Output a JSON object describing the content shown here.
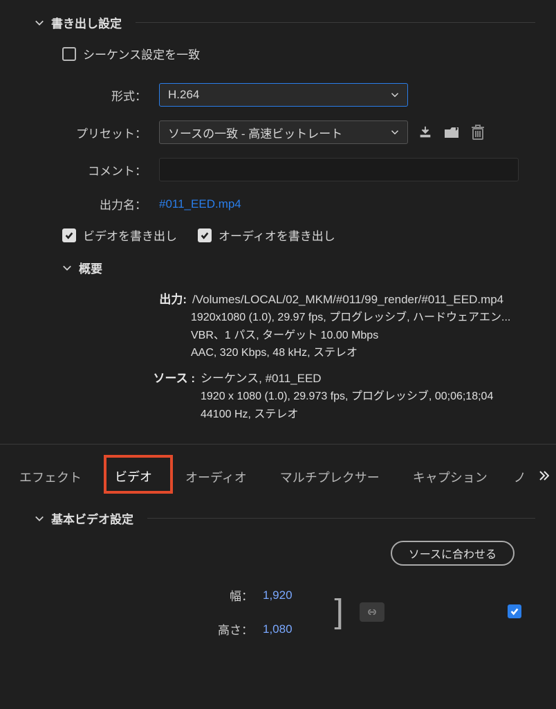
{
  "export_settings": {
    "title": "書き出し設定",
    "match_sequence_label": "シーケンス設定を一致",
    "format_label": "形式：",
    "format_value": "H.264",
    "preset_label": "プリセット：",
    "preset_value": "ソースの一致 - 高速ビットレート",
    "comment_label": "コメント：",
    "comment_value": "",
    "output_name_label": "出力名：",
    "output_name_value": "#011_EED.mp4",
    "export_video_label": "ビデオを書き出し",
    "export_audio_label": "オーディオを書き出し"
  },
  "summary": {
    "title": "概要",
    "output_key": "出力:",
    "output_path": "/Volumes/LOCAL/02_MKM/#011/99_render/#011_EED.mp4",
    "output_line2": "1920x1080 (1.0), 29.97 fps, プログレッシブ, ハードウェアエン...",
    "output_line3": "VBR、1 パス, ターゲット 10.00 Mbps",
    "output_line4": "AAC, 320 Kbps, 48 kHz, ステレオ",
    "source_key": "ソース :",
    "source_line1": "シーケンス, #011_EED",
    "source_line2": "1920 x 1080 (1.0), 29.973 fps, プログレッシブ, 00;06;18;04",
    "source_line3": "44100 Hz, ステレオ"
  },
  "tabs": {
    "effects": "エフェクト",
    "video": "ビデオ",
    "audio": "オーディオ",
    "multiplexer": "マルチプレクサー",
    "caption": "キャプション",
    "more": "ノ"
  },
  "basic_video": {
    "title": "基本ビデオ設定",
    "match_source_btn": "ソースに合わせる",
    "width_label": "幅：",
    "width_value": "1,920",
    "height_label": "高さ：",
    "height_value": "1,080"
  }
}
